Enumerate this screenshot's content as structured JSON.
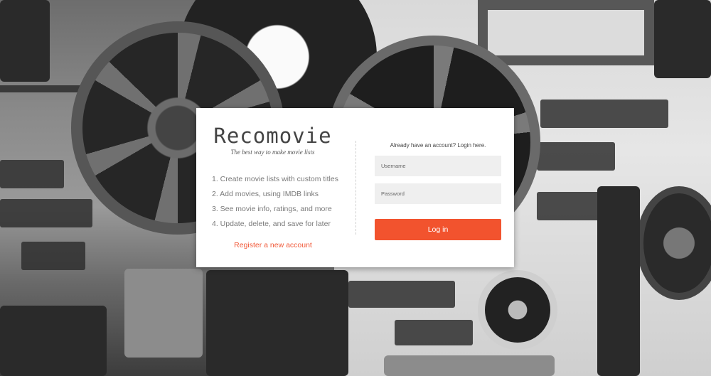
{
  "app": {
    "name": "Recomovie",
    "tagline": "The best way to make movie lists"
  },
  "features": [
    "1. Create movie lists with custom titles",
    "2. Add movies, using IMDB links",
    "3. See movie info, ratings, and more",
    "4. Update, delete, and save for later"
  ],
  "register": {
    "label": "Register a new account"
  },
  "login": {
    "prompt": "Already have an account? Login here.",
    "username_placeholder": "Username",
    "password_placeholder": "Password",
    "button_label": "Log in"
  },
  "colors": {
    "accent": "#f2532e",
    "register_link": "#f15a3a",
    "card_bg": "#ffffff",
    "field_bg": "#efefef"
  }
}
